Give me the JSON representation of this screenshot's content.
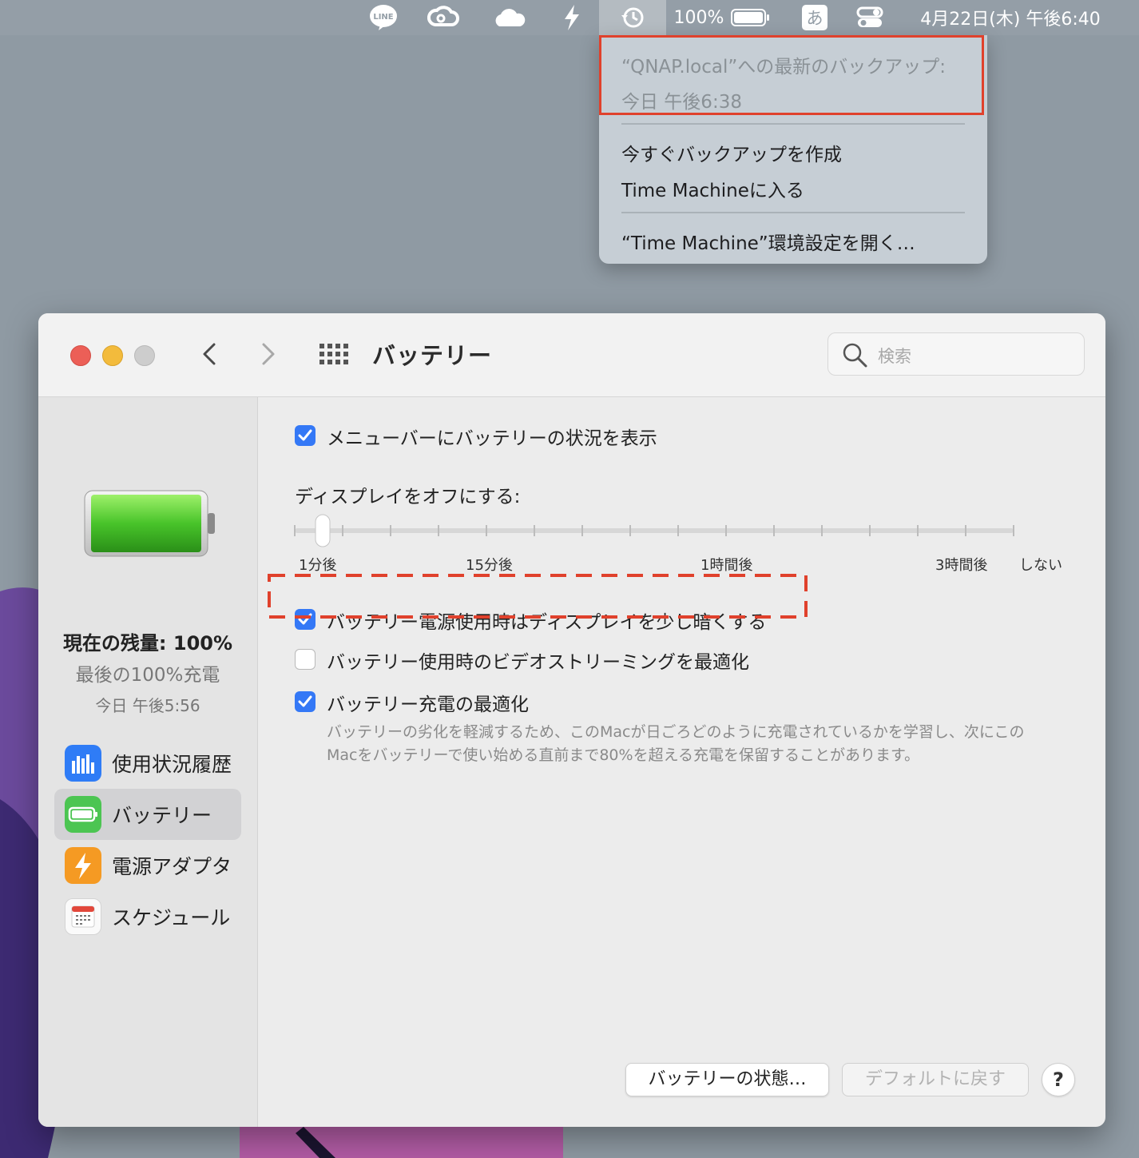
{
  "menubar": {
    "battery_percent": "100%",
    "input_method": "あ",
    "clock": "4月22日(木) 午後6:40",
    "icons": [
      "line-icon",
      "creative-cloud-icon",
      "onedrive-icon",
      "bolt-app-icon",
      "time-machine-icon",
      "battery-icon",
      "input-method-icon",
      "control-center-icon"
    ],
    "line_label": "LINE"
  },
  "time_machine_menu": {
    "latest_backup_line1": "“QNAP.local”への最新のバックアップ:",
    "latest_backup_line2": "今日 午後6:38",
    "items": [
      "今すぐバックアップを作成",
      "Time Machineに入る",
      "“Time Machine”環境設定を開く…"
    ]
  },
  "window": {
    "title": "バッテリー",
    "search_placeholder": "検索"
  },
  "sidebar": {
    "battery_level_label": "現在の残量: 100%",
    "last_full_charge": "最後の100%充電",
    "last_full_charge_time": "今日 午後5:56",
    "items": [
      {
        "label": "使用状況履歴",
        "icon": "usage-history-icon",
        "color": "#2f7cf6"
      },
      {
        "label": "バッテリー",
        "icon": "battery-pane-icon",
        "color": "#4cc552",
        "selected": true
      },
      {
        "label": "電源アダプタ",
        "icon": "power-adapter-icon",
        "color": "#f59a23"
      },
      {
        "label": "スケジュール",
        "icon": "schedule-icon",
        "color": "#ffffff"
      }
    ]
  },
  "content": {
    "show_in_menubar": {
      "label": "メニューバーにバッテリーの状況を表示",
      "checked": true
    },
    "display_off_label": "ディスプレイをオフにする:",
    "slider": {
      "value_label": "1分後",
      "tick_count": 16,
      "selected_index": 0,
      "labels": [
        "1分後",
        "15分後",
        "1時間後",
        "3時間後",
        "しない"
      ]
    },
    "dim_display": {
      "label": "バッテリー電源使用時はディスプレイを少し暗くする",
      "checked": true
    },
    "optimize_video": {
      "label": "バッテリー使用時のビデオストリーミングを最適化",
      "checked": false
    },
    "optimize_charging": {
      "label": "バッテリー充電の最適化",
      "checked": true,
      "description_line1": "バッテリーの劣化を軽減するため、このMacが日ごろどのように充電されているかを学習し、次にこの",
      "description_line2": "Macをバッテリーで使い始める直前まで80%を超える充電を保留することがあります。"
    }
  },
  "buttons": {
    "battery_health": "バッテリーの状態…",
    "restore_defaults": "デフォルトに戻す",
    "help": "?"
  },
  "colors": {
    "accent": "#3478f6",
    "annotation_red": "#e0412c"
  }
}
